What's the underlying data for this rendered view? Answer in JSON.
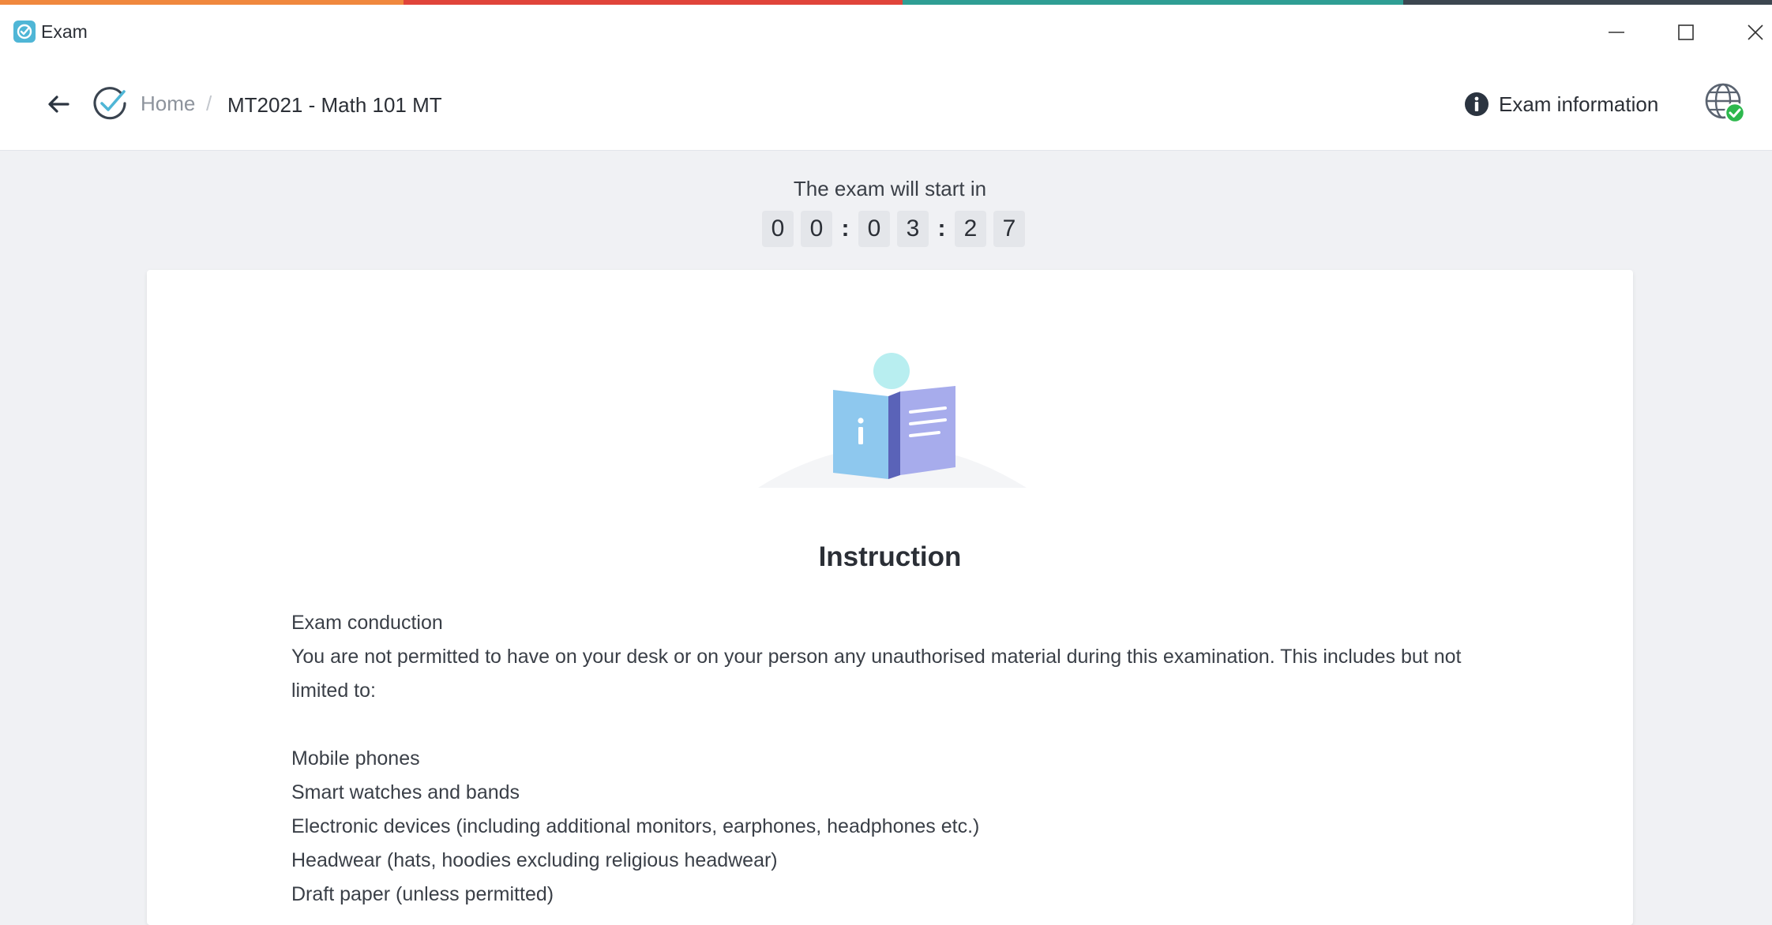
{
  "window": {
    "title": "Exam",
    "controls": [
      "minimize-icon",
      "maximize-icon",
      "close-icon"
    ]
  },
  "header": {
    "breadcrumb": {
      "home": "Home",
      "separator": "/",
      "current": "MT2021 - Math 101 MT"
    },
    "exam_info_label": "Exam information"
  },
  "countdown": {
    "label": "The exam will start in",
    "digits": [
      "0",
      "0",
      "0",
      "3",
      "2",
      "7"
    ],
    "separator": ":"
  },
  "instruction": {
    "title": "Instruction",
    "heading": "Exam conduction",
    "intro": "You are not permitted to have on your desk or on your person any unauthorised material during this examination. This includes but not limited to:",
    "items": [
      "Mobile phones",
      "Smart watches and bands",
      "Electronic devices (including additional monitors, earphones, headphones etc.)",
      "Headwear (hats, hoodies excluding religious headwear)",
      "Draft paper (unless permitted)"
    ]
  },
  "colors": {
    "stripe_orange": "#f0883e",
    "stripe_red": "#e0443a",
    "stripe_teal": "#2f9e94",
    "stripe_dark": "#3c4650",
    "accent": "#4fb6d6",
    "status_ok": "#2db84d"
  }
}
